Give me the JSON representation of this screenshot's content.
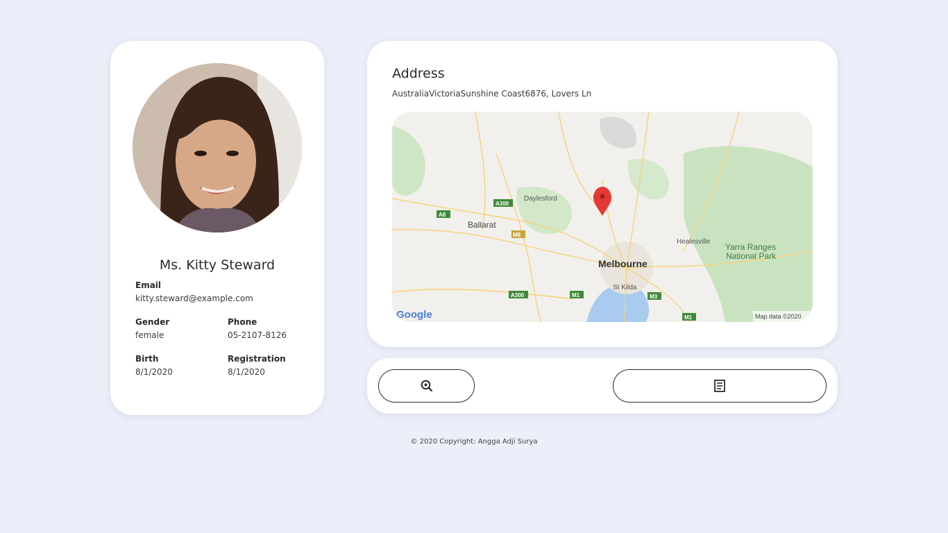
{
  "profile": {
    "name": "Ms. Kitty Steward",
    "email_label": "Email",
    "email": "kitty.steward@example.com",
    "gender_label": "Gender",
    "gender": "female",
    "phone_label": "Phone",
    "phone": "05-2107-8126",
    "birth_label": "Birth",
    "birth": "8/1/2020",
    "registration_label": "Registration",
    "registration": "8/1/2020"
  },
  "address": {
    "title": "Address",
    "text": "AustraliaVictoriaSunshine Coast6876, Lovers Ln"
  },
  "map": {
    "places": {
      "daylesford": "Daylesford",
      "ballarat": "Ballarat",
      "melbourne": "Melbourne",
      "st_kilda": "St Kilda",
      "healesville": "Healesville",
      "yarra_1": "Yarra Ranges",
      "yarra_2": "National Park"
    },
    "roads": {
      "a300_top": "A300",
      "a8": "A8",
      "m8": "M8",
      "a300_bottom": "A300",
      "m1_left": "M1",
      "m3": "M3",
      "m1_bottom": "M1"
    },
    "logo": "Google",
    "attribution": "Map data ©2020",
    "marker_color": "#e53935"
  },
  "actions": {
    "search_icon": "search-icon",
    "details_icon": "document-icon"
  },
  "footer": {
    "copyright": "© 2020 Copyright: Angga Adji Surya"
  },
  "colors": {
    "background": "#eceff9",
    "card": "#ffffff",
    "text": "#2b2b2b"
  }
}
